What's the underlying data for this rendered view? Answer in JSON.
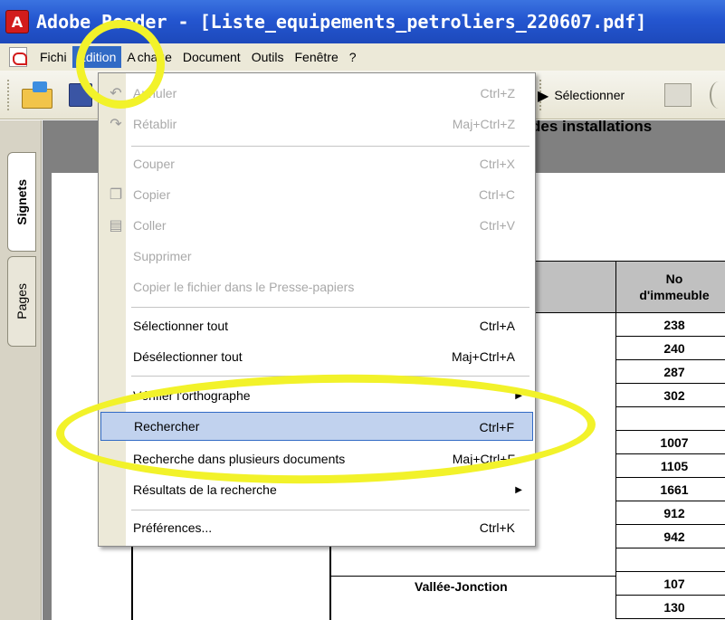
{
  "window": {
    "title": "Adobe Reader - [Liste_equipements_petroliers_220607.pdf]",
    "title_parts": [
      "Adobe",
      "eader",
      "[Liste_equipements_petroliers_220607.pdf]"
    ]
  },
  "menubar": {
    "items": [
      "Fichi",
      "Edition",
      "A",
      "chage",
      "Document",
      "Outils",
      "Fenêtre",
      "?"
    ],
    "active": "Edition"
  },
  "toolbar": {
    "select_label": "Sélectionner"
  },
  "navpanel": {
    "tabs": [
      "Signets",
      "Pages"
    ]
  },
  "edit_menu": {
    "items": [
      {
        "label": "Annuler",
        "shortcut": "Ctrl+Z",
        "enabled": false,
        "icon": "undo-icon"
      },
      {
        "label": "Rétablir",
        "shortcut": "Maj+Ctrl+Z",
        "enabled": false,
        "icon": "redo-icon"
      },
      {
        "label": "Couper",
        "shortcut": "Ctrl+X",
        "enabled": false
      },
      {
        "label": "Copier",
        "shortcut": "Ctrl+C",
        "enabled": false,
        "icon": "copy-icon"
      },
      {
        "label": "Coller",
        "shortcut": "Ctrl+V",
        "enabled": false,
        "icon": "paste-icon"
      },
      {
        "label": "Supprimer",
        "shortcut": "",
        "enabled": false
      },
      {
        "label": "Copier le fichier dans le Presse-papiers",
        "shortcut": "",
        "enabled": false
      },
      {
        "label": "Sélectionner tout",
        "shortcut": "Ctrl+A",
        "enabled": true
      },
      {
        "label": "Désélectionner tout",
        "shortcut": "Maj+Ctrl+A",
        "enabled": true
      },
      {
        "label": "Vérifier l'orthographe",
        "shortcut": "",
        "enabled": true,
        "submenu": true
      },
      {
        "label": "Rechercher",
        "shortcut": "Ctrl+F",
        "enabled": true,
        "highlighted": true
      },
      {
        "label": "Recherche dans plusieurs documents",
        "shortcut": "Maj+Ctrl+F",
        "enabled": true
      },
      {
        "label": "Résultats de la recherche",
        "shortcut": "",
        "enabled": true,
        "submenu": true
      },
      {
        "label": "Préférences...",
        "shortcut": "Ctrl+K",
        "enabled": true
      }
    ]
  },
  "document": {
    "heading": "gistre des installations",
    "column_header": [
      "No",
      "d'immeuble"
    ],
    "numbers": [
      "238",
      "240",
      "287",
      "302",
      "",
      "1007",
      "1105",
      "1661",
      "912",
      "942",
      "",
      "107",
      "130"
    ],
    "city": "Vallée-Jonction"
  },
  "colors": {
    "accent": "#316ac5",
    "annotation": "#f2f22a",
    "titlebar": "#2456d0"
  }
}
